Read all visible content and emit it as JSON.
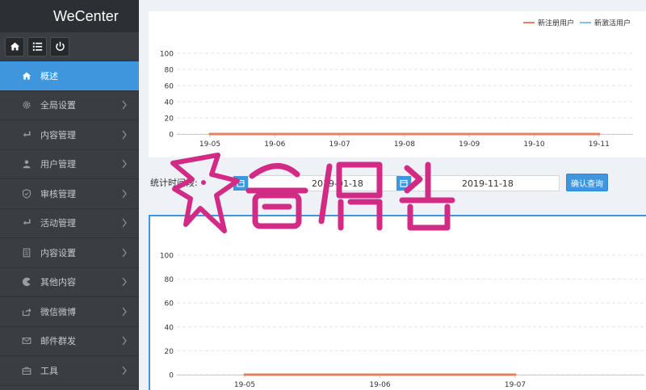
{
  "app": {
    "brand": "WeCenter"
  },
  "quickbar": [
    {
      "name": "home-button",
      "icon": "home-icon"
    },
    {
      "name": "list-button",
      "icon": "list-icon"
    },
    {
      "name": "logout-button",
      "icon": "power-icon"
    }
  ],
  "sidebar": {
    "items": [
      {
        "label": "概述",
        "icon": "home-icon",
        "active": true
      },
      {
        "label": "全局设置",
        "icon": "gear-icon"
      },
      {
        "label": "内容管理",
        "icon": "return-icon"
      },
      {
        "label": "用户管理",
        "icon": "user-icon"
      },
      {
        "label": "审核管理",
        "icon": "shield-icon"
      },
      {
        "label": "活动管理",
        "icon": "return-icon"
      },
      {
        "label": "内容设置",
        "icon": "document-icon"
      },
      {
        "label": "其他内容",
        "icon": "pacman-icon"
      },
      {
        "label": "微信微博",
        "icon": "share-icon"
      },
      {
        "label": "邮件群发",
        "icon": "mail-icon"
      },
      {
        "label": "工具",
        "icon": "toolbox-icon"
      }
    ]
  },
  "filter": {
    "label": "统计时间段:",
    "start_date": "2019-01-18",
    "end_date": "2019-11-18",
    "query_button": "确认查询"
  },
  "colors": {
    "accent": "#3e97dc",
    "sidebar": "#3a3d41",
    "series_register": "#e8805f",
    "series_active": "#7ec3e6"
  },
  "chart_data": [
    {
      "type": "line",
      "categories": [
        "19-05",
        "19-06",
        "19-07",
        "19-08",
        "19-09",
        "19-10",
        "19-11"
      ],
      "series": [
        {
          "name": "新注册用户",
          "values": [
            0,
            0,
            0,
            0,
            0,
            0,
            0
          ]
        },
        {
          "name": "新激活用户",
          "values": [
            0,
            0,
            0,
            0,
            0,
            0,
            0
          ]
        }
      ],
      "ylim": [
        0,
        100
      ],
      "yticks": [
        0,
        20,
        40,
        60,
        80,
        100
      ],
      "grid": true,
      "legend": "top-right"
    },
    {
      "type": "line",
      "categories": [
        "19-05",
        "19-06",
        "19-07"
      ],
      "series": [
        {
          "values": [
            0,
            0,
            0
          ]
        }
      ],
      "ylim": [
        0,
        100
      ],
      "yticks": [
        0,
        20,
        40,
        60,
        80,
        100
      ],
      "grid": true,
      "legend": "none"
    }
  ]
}
